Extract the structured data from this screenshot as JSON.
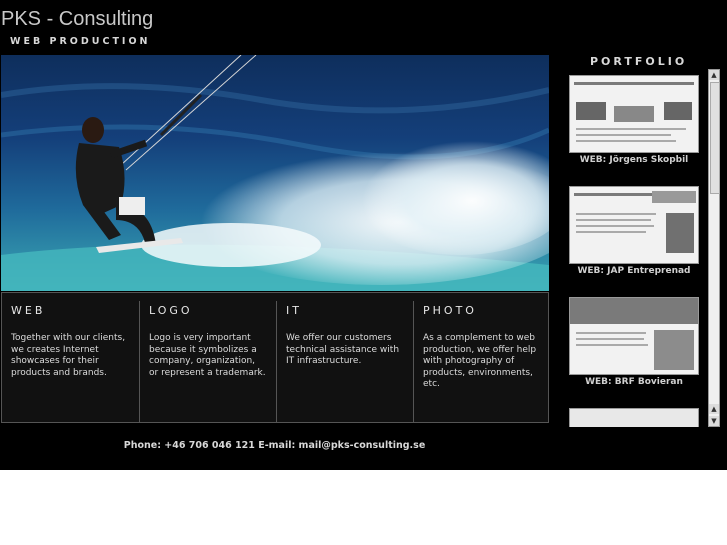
{
  "site": {
    "title": "PKS - Consulting",
    "tagline": "WEB PRODUCTION"
  },
  "services": [
    {
      "title": "WEB",
      "text": "Together with our clients, we creates Internet showcases for their products and brands."
    },
    {
      "title": "LOGO",
      "text": "Logo is very important because it symbolizes a company, organization, or represent a trademark."
    },
    {
      "title": "IT",
      "text": "We offer our customers technical assistance with IT infrastructure."
    },
    {
      "title": "PHOTO",
      "text": "As a complement to web production, we offer help with photography of products, environments, etc."
    }
  ],
  "footer": {
    "contact": "Phone: +46 706 046 121  E-mail: mail@pks-consulting.se"
  },
  "portfolio": {
    "title": "PORTFOLIO",
    "items": [
      {
        "label": "WEB: Jörgens Skopbil"
      },
      {
        "label": "WEB: JAP Entreprenad"
      },
      {
        "label": "WEB: BRF Bovieran"
      }
    ]
  },
  "scrollbar": {
    "up_icon": "arrow-up-icon",
    "down_icon": "arrow-down-icon"
  }
}
